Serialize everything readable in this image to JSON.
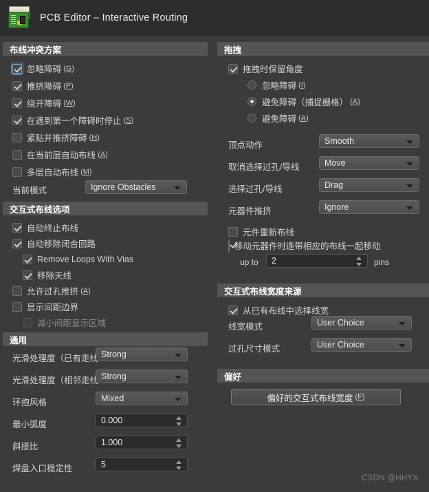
{
  "window": {
    "title": "PCB Editor – Interactive Routing",
    "icon": "pcb-board-icon"
  },
  "sections": {
    "routing_conflict": {
      "title": "布线冲突方案",
      "checkboxes": [
        {
          "label": "忽略障碍",
          "accel": "G",
          "checked": true,
          "focused": true,
          "disabled": false
        },
        {
          "label": "推挤障碍",
          "accel": "P",
          "checked": true,
          "focused": false,
          "disabled": false
        },
        {
          "label": "绕开障碍",
          "accel": "W",
          "checked": true,
          "focused": false,
          "disabled": false
        },
        {
          "label": "在遇到第一个障碍时停止",
          "accel": "S",
          "checked": true,
          "focused": false,
          "disabled": false
        },
        {
          "label": "紧贴并推挤障碍",
          "accel": "H",
          "checked": false,
          "focused": false,
          "disabled": false
        },
        {
          "label": "在当前层自动布线",
          "accel": "A",
          "checked": false,
          "focused": false,
          "disabled": false
        },
        {
          "label": "多层自动布线",
          "accel": "M",
          "checked": false,
          "focused": false,
          "disabled": false
        }
      ],
      "current_mode": {
        "label": "当前模式",
        "value": "Ignore Obstacles"
      }
    },
    "interactive_routing": {
      "title": "交互式布线选项",
      "items": [
        {
          "label": "自动终止布线",
          "accel": "",
          "checked": true,
          "indent": 0,
          "disabled": false
        },
        {
          "label": "自动移除闭合回路",
          "accel": "",
          "checked": true,
          "indent": 0,
          "disabled": false
        },
        {
          "label": "Remove Loops With Vias",
          "accel": "",
          "checked": true,
          "indent": 1,
          "disabled": false
        },
        {
          "label": "移除天线",
          "accel": "",
          "checked": true,
          "indent": 1,
          "disabled": false
        },
        {
          "label": "允许过孔推挤",
          "accel": "A",
          "checked": false,
          "indent": 0,
          "disabled": false
        },
        {
          "label": "显示间距边界",
          "accel": "",
          "checked": false,
          "indent": 0,
          "disabled": false
        },
        {
          "label": "减小间距显示区域",
          "accel": "",
          "checked": false,
          "indent": 1,
          "disabled": true
        }
      ]
    },
    "general": {
      "title": "通用",
      "fields": [
        {
          "label": "光滑处理度（已有走线）",
          "value": "Strong",
          "type": "combo"
        },
        {
          "label": "光滑处理度（相邻走线）",
          "value": "Strong",
          "type": "combo"
        },
        {
          "label": "环抱风格",
          "value": "Mixed",
          "type": "combo"
        },
        {
          "label": "最小弧度",
          "value": "0.000",
          "type": "spin"
        },
        {
          "label": "斜接比",
          "value": "1.000",
          "type": "spin"
        },
        {
          "label": "焊盘入口稳定性",
          "value": "5",
          "type": "spin"
        }
      ]
    },
    "drag": {
      "title": "拖拽",
      "keep_angle": {
        "label": "拖拽时保留角度",
        "checked": true
      },
      "radios": [
        {
          "label": "忽略障碍",
          "suffix": "",
          "accel": "I",
          "selected": false
        },
        {
          "label": "避免障碍",
          "suffix": "（捕捉栅格）",
          "accel": "A",
          "selected": true
        },
        {
          "label": "避免障碍",
          "suffix": "",
          "accel": "A",
          "selected": false
        }
      ],
      "fields": [
        {
          "label": "顶点动作",
          "value": "Smooth"
        },
        {
          "label": "取消选择过孔/导线",
          "value": "Move"
        },
        {
          "label": "选择过孔/导线",
          "value": "Drag"
        },
        {
          "label": "元器件推挤",
          "value": "Ignore"
        }
      ],
      "component_reroute": {
        "label": "元件重新布线",
        "checked": false
      },
      "move_with_traces": {
        "label": "移动元器件时连带相应的布线一起移动",
        "checked": true
      },
      "up_to": {
        "prefix": "up to",
        "value": "2",
        "suffix": "pins"
      }
    },
    "width_source": {
      "title": "交互式布线宽度来源",
      "pick_from_existing": {
        "label": "从已有布线中选择线宽",
        "checked": true
      },
      "fields": [
        {
          "label": "线宽模式",
          "value": "User Choice"
        },
        {
          "label": "过孔尺寸模式",
          "value": "User Choice"
        }
      ]
    },
    "preferences": {
      "title": "偏好",
      "button": {
        "label": "偏好的交互式布线宽度",
        "accel": "F"
      }
    }
  },
  "watermark": "CSDN @HHYX."
}
